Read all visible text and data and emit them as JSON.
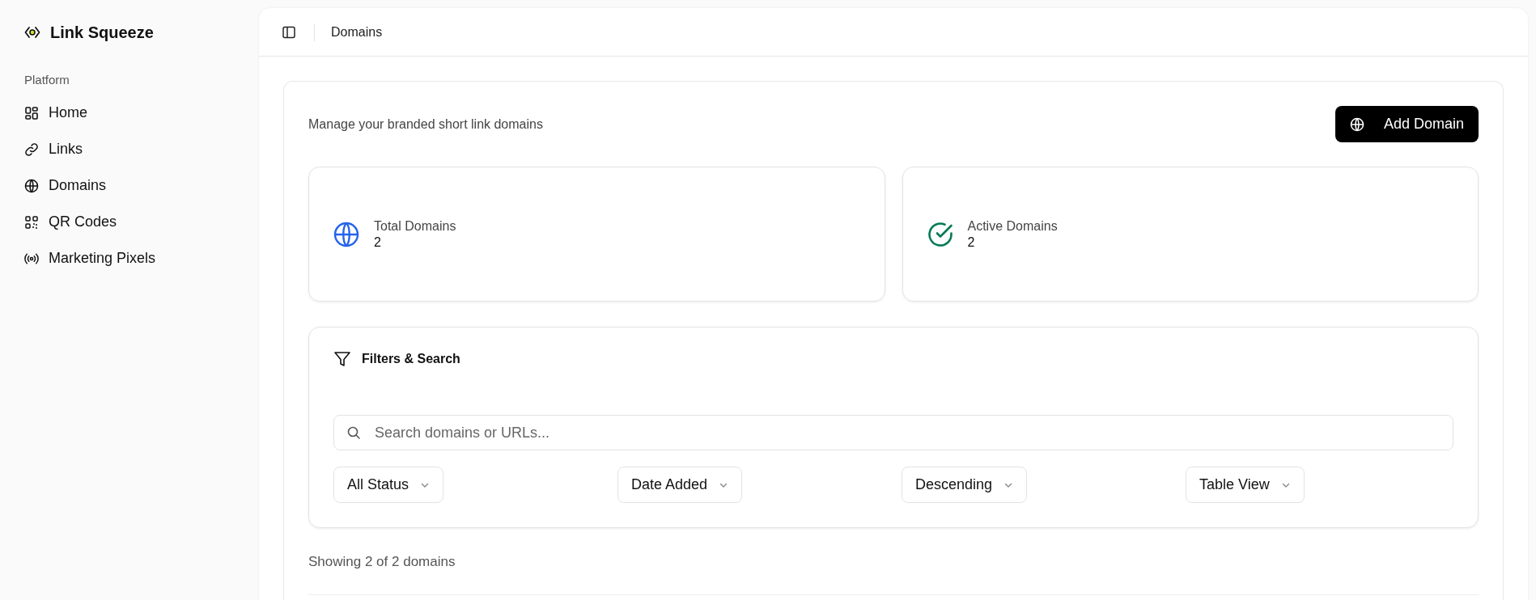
{
  "sidebar": {
    "brand": "Link Squeeze",
    "section": "Platform",
    "items": [
      {
        "label": "Home",
        "kind": "grid"
      },
      {
        "label": "Links",
        "kind": "link"
      },
      {
        "label": "Domains",
        "kind": "globe"
      },
      {
        "label": "QR Codes",
        "kind": "qr"
      },
      {
        "label": "Marketing Pixels",
        "kind": "signal"
      }
    ]
  },
  "header": {
    "breadcrumb": "Domains"
  },
  "page": {
    "description": "Manage your branded short link domains",
    "add_button": "Add Domain"
  },
  "stats": [
    {
      "label": "Total Domains",
      "value": "2",
      "kind": "globe",
      "color": "#2563eb"
    },
    {
      "label": "Active Domains",
      "value": "2",
      "kind": "check",
      "color": "#047a55"
    }
  ],
  "filters": {
    "title": "Filters & Search",
    "search": {
      "placeholder": "Search domains or URLs..."
    },
    "selects": [
      "All Status",
      "Date Added",
      "Descending",
      "Table View"
    ]
  },
  "summary": "Showing 2 of 2 domains"
}
